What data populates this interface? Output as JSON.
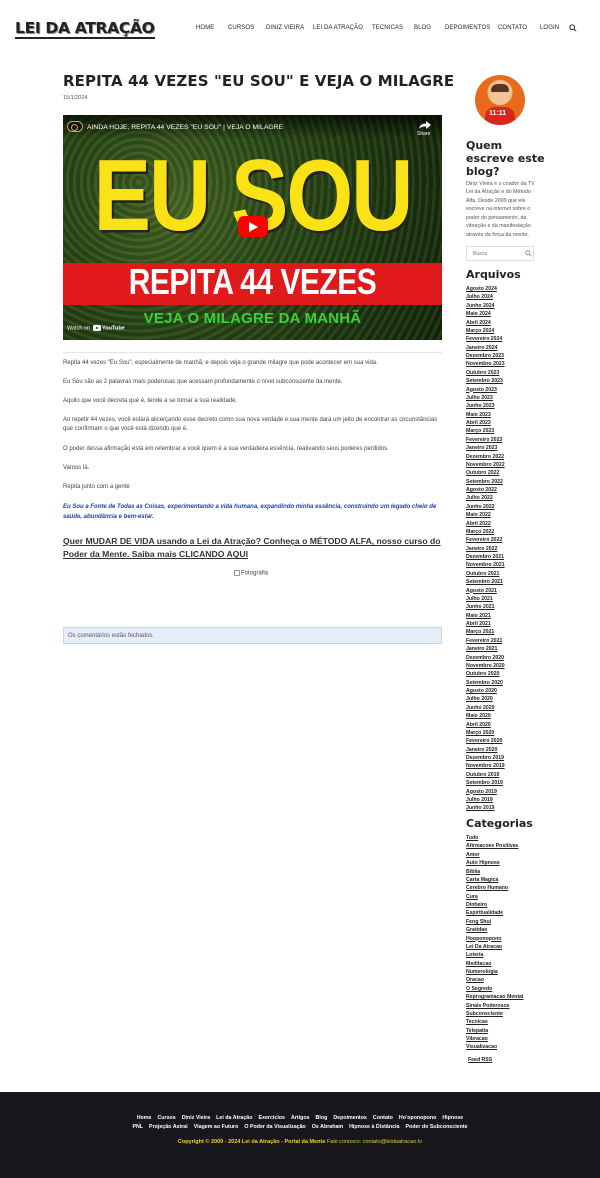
{
  "header": {
    "logo": "LEI DA ATRAÇÃO",
    "nav": [
      "Home",
      "CURSOS",
      "DINIZ VIEIRA",
      "LEI DA ATRAÇÃO",
      "TECNICAS",
      "BLOG",
      "DEPOIMENTOS",
      "CONTATO",
      "LOGIN"
    ],
    "search_icon": "search-icon"
  },
  "post": {
    "title": "REPITA 44 VEZES \"EU SOU\" E VEJA O MILAGRE",
    "date": "15/1/2024",
    "video": {
      "title": "AINDA HOJE, REPITA 44 VEZES \"EU SOU\" | VEJA O MILAGRE",
      "share": "Share",
      "big_text": "EU SOU",
      "band_text": "REPITA 44 VEZES",
      "sub_text": "VEJA O MILAGRE DA MANHÃ",
      "watch_on": "Watch on",
      "youtube": "YouTube"
    },
    "paragraphs": [
      "Repita 44 vezes \"Eu Sou\", especialmente de manhã, e depois veja o grande milagre que pode acontecer em sua vida.",
      "Eu Sou são as 2 palavras mais poderosas que acessam profundamente o nível subconsciente da mente.",
      "Aquilo que você decreta que é, tende a se tornar a sua realidade.",
      "Ao repetir 44 vezes, você estará alicerçando esse decreto como sua nova verdade e sua mente dará um jeito de encontrar as circunstâncias que confirmam o que você está dizendo que é.",
      "O poder dessa afirmação está em relembrar a você quem é a sua verdadeira essência, reativando seus poderes perdidos.",
      "Vamos lá.",
      "Repita junto com a gente"
    ],
    "highlight": "Eu Sou a Fonte de Todas as Coisas, experimentando a vida humana, expandindo minha essência, construindo um legado cheio de saúde, abundância e bem-estar.",
    "cta": "Quer MUDAR DE VIDA usando a Lei da Atração? Conheça o MÉTODO ALFA, nosso curso do Poder da Mente. Saiba mais CLICANDO AQUI",
    "photo_alt": "Fotografia",
    "comments_closed": "Os comentários estão fechados."
  },
  "sidebar": {
    "avatar_text": "11:11",
    "about_title": "Quem escreve este blog?",
    "about_text": "Diniz Vieira é o criador da TV Lei da Atração e do Método Alfa. Desde 2009 que ele escreve na internet sobre o poder do pensamento, da vibração e da manifestação através da força da mente.",
    "search_placeholder": "Busca",
    "archives_title": "Arquivos",
    "archives": [
      "Agosto 2024",
      "Julho 2024",
      "Junho 2024",
      "Maio 2024",
      "Abril 2024",
      "Março 2024",
      "Fevereiro 2024",
      "Janeiro 2024",
      "Dezembro 2023",
      "Novembro 2023",
      "Outubro 2023",
      "Setembro 2023",
      "Agosto 2023",
      "Julho 2023",
      "Junho 2023",
      "Maio 2023",
      "Abril 2023",
      "Março 2023",
      "Fevereiro 2023",
      "Janeiro 2023",
      "Dezembro 2022",
      "Novembro 2022",
      "Outubro 2022",
      "Setembro 2022",
      "Agosto 2022",
      "Julho 2022",
      "Junho 2022",
      "Maio 2022",
      "Abril 2022",
      "Março 2022",
      "Fevereiro 2022",
      "Janeiro 2022",
      "Dezembro 2021",
      "Novembro 2021",
      "Outubro 2021",
      "Setembro 2021",
      "Agosto 2021",
      "Julho 2021",
      "Junho 2021",
      "Maio 2021",
      "Abril 2021",
      "Março 2021",
      "Fevereiro 2021",
      "Janeiro 2021",
      "Dezembro 2020",
      "Novembro 2020",
      "Outubro 2020",
      "Setembro 2020",
      "Agosto 2020",
      "Julho 2020",
      "Junho 2020",
      "Maio 2020",
      "Abril 2020",
      "Março 2020",
      "Fevereiro 2020",
      "Janeiro 2020",
      "Dezembro 2019",
      "Novembro 2019",
      "Outubro 2019",
      "Setembro 2019",
      "Agosto 2019",
      "Julho 2019",
      "Junho 2019"
    ],
    "categories_title": "Categorias",
    "categories": [
      "Tudo",
      "Afirmacoes Positivas",
      "Amor",
      "Auto Hipnose",
      "Bíblia",
      "Carta Magica",
      "Cerebro Humano",
      "Cura",
      "Dinheiro",
      "Espiritualidade",
      "Feng Shui",
      "Gratidao",
      "Hooponopono",
      "Lei Da Atracao",
      "Loteria",
      "Meditacao",
      "Numerologia",
      "Oracao",
      "O Segredo",
      "Reprogramacao Mental",
      "Sinais Poderosos",
      "Subconsciente",
      "Tecnicas",
      "Telepatia",
      "Vibracao",
      "Visualizacao"
    ],
    "feed": "Feed RSS"
  },
  "footer": {
    "row1": [
      "Home",
      "Cursos",
      "Diniz Vieira",
      "Lei da Atração",
      "Exercícios",
      "Artigos",
      "Blog",
      "Depoimentos",
      "Contato",
      "Ho'oponopono",
      "Hipnose"
    ],
    "row2": [
      "PNL",
      "Projeção Astral",
      "Viagem ao Futuro",
      "O Poder da Visualização",
      "Os Abraham",
      "Hipnose à Distância",
      "Poder do Subconsciente"
    ],
    "copyright_strong": "Copyright © 2009 - 2024 Lei da Atração - Portal da Mente",
    "copyright_rest": "Fale conosco: contato@leidaatracao.tv"
  },
  "colors": {
    "accent_blue": "#1d3fb5",
    "youtube_red": "#ff0000",
    "footer_bg": "#18181c",
    "footer_gold": "#f2d323"
  }
}
